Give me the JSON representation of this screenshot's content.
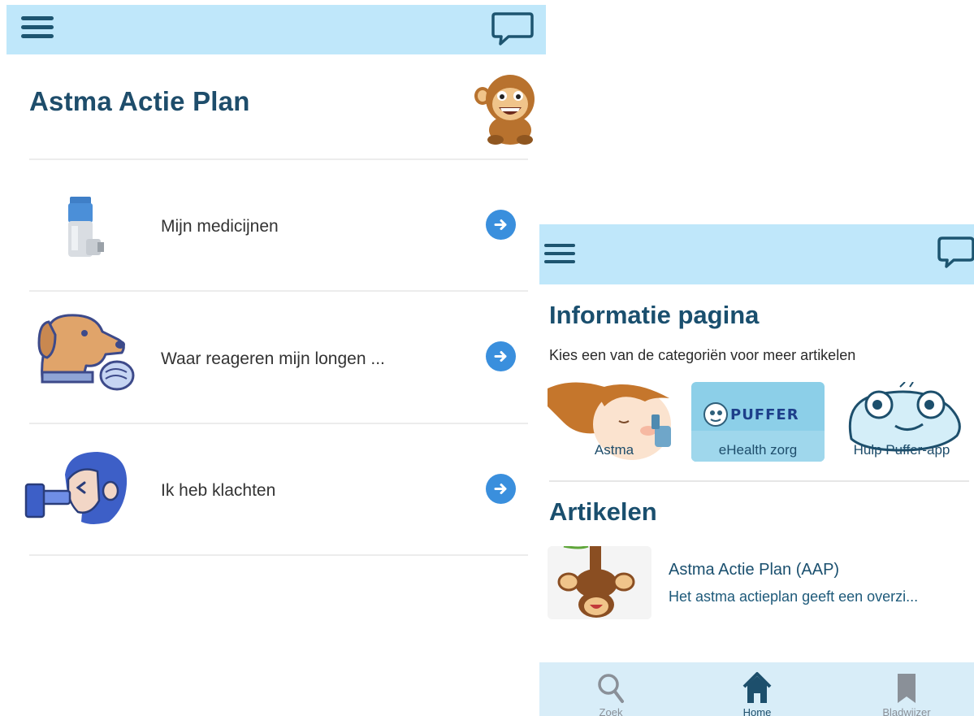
{
  "left_screen": {
    "title": "Astma Actie Plan",
    "rows": [
      {
        "label": "Mijn medicijnen",
        "icon": "inhaler-icon"
      },
      {
        "label": "Waar reageren mijn longen ...",
        "icon": "dog-allergy-icon"
      },
      {
        "label": "Ik heb klachten",
        "icon": "child-inhaler-icon"
      }
    ]
  },
  "right_screen": {
    "title": "Informatie pagina",
    "subtitle": "Kies een van de categoriën voor meer artikelen",
    "categories": [
      {
        "label": "Astma"
      },
      {
        "label": "eHealth zorg",
        "logo_text": "PUFFER"
      },
      {
        "label": "Hulp Puffer-app"
      }
    ],
    "articles_title": "Artikelen",
    "articles": [
      {
        "title": "Astma Actie Plan (AAP)",
        "description": "Het astma actieplan geeft een overzi..."
      }
    ],
    "bottom_nav": [
      {
        "label": "Zoek",
        "icon": "search-icon"
      },
      {
        "label": "Home",
        "icon": "home-icon"
      },
      {
        "label": "Bladwijzer",
        "icon": "bookmark-icon"
      }
    ]
  },
  "colors": {
    "topbar": "#bfe7fa",
    "primary_text": "#1a4f6e",
    "arrow_button": "#3a8fdd",
    "bottom_nav": "#d8edf8"
  }
}
